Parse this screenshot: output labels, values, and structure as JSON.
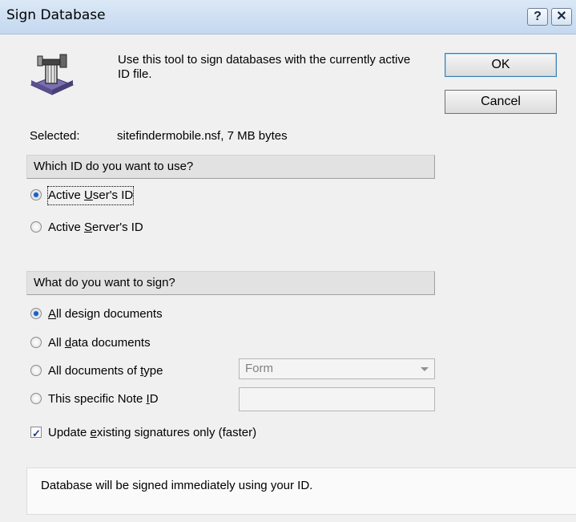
{
  "window": {
    "title": "Sign Database",
    "help_label": "?",
    "close_label": "✕"
  },
  "header": {
    "description": "Use this tool to sign databases with the currently active ID file."
  },
  "buttons": {
    "ok": "OK",
    "cancel": "Cancel"
  },
  "selected": {
    "label": "Selected:",
    "value": "sitefindermobile.nsf, 7 MB bytes"
  },
  "id_group": {
    "title": "Which ID do you want to use?",
    "options": [
      {
        "pre": "Active ",
        "key": "U",
        "post": "ser's ID",
        "checked": true
      },
      {
        "pre": "Active ",
        "key": "S",
        "post": "erver's ID",
        "checked": false
      }
    ]
  },
  "sign_group": {
    "title": "What do you want to sign?",
    "options": [
      {
        "pre": "",
        "key": "A",
        "post": "ll design documents",
        "checked": true
      },
      {
        "pre": "All ",
        "key": "d",
        "post": "ata documents",
        "checked": false
      },
      {
        "pre": "All documents of ",
        "key": "t",
        "post": "ype",
        "checked": false
      },
      {
        "pre": "This specific Note ",
        "key": "I",
        "post": "D",
        "checked": false
      }
    ],
    "doc_type_value": "Form",
    "note_id_value": ""
  },
  "update_option": {
    "pre": "Update ",
    "key": "e",
    "post": "xisting signatures only (faster)",
    "checked": true
  },
  "status_message": "Database will be signed immediately using your ID.",
  "icons": {
    "tool": "sign-tool-icon"
  }
}
